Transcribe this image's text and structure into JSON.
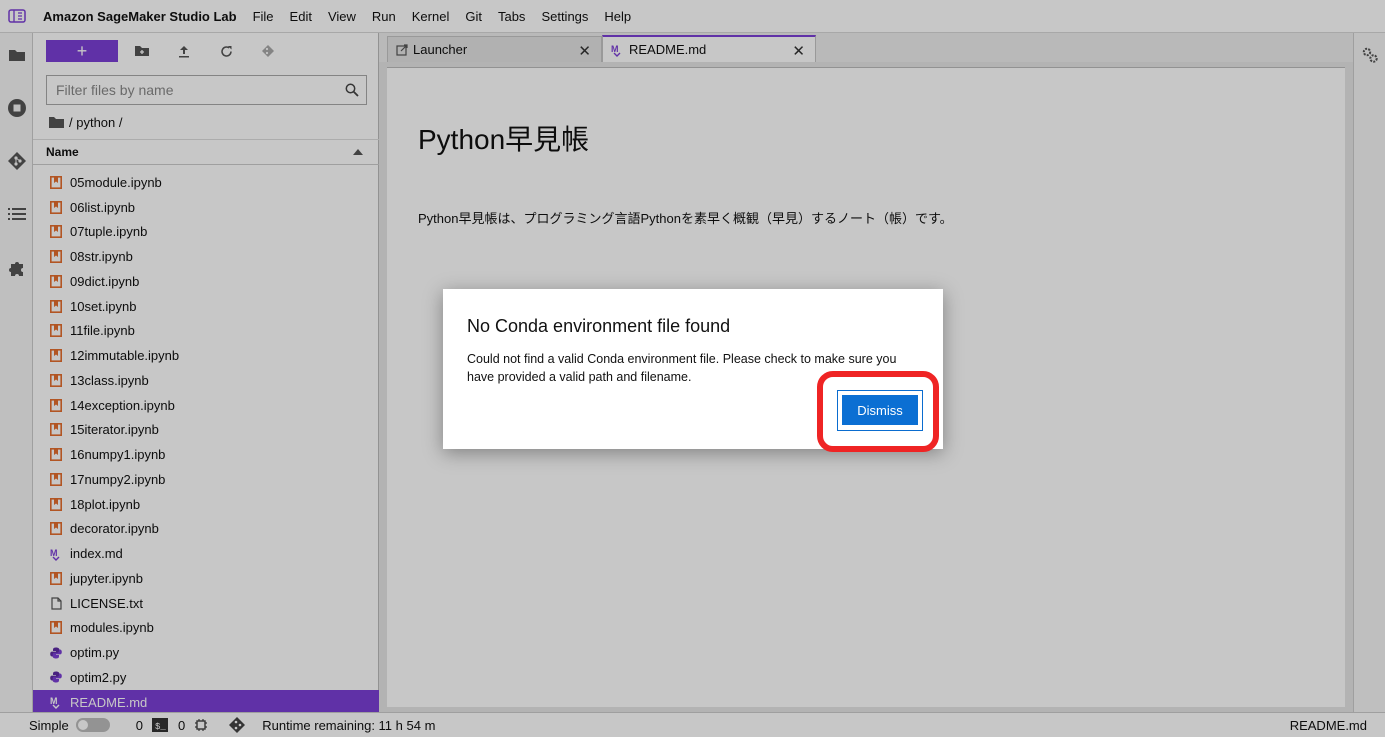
{
  "app": {
    "title": "Amazon SageMaker Studio Lab"
  },
  "menu": [
    "File",
    "Edit",
    "View",
    "Run",
    "Kernel",
    "Git",
    "Tabs",
    "Settings",
    "Help"
  ],
  "file_browser": {
    "new_button_label": "+",
    "filter_placeholder": "Filter files by name",
    "breadcrumb": "/ python /",
    "column_name": "Name",
    "files": [
      {
        "name": "05module.ipynb",
        "type": "notebook"
      },
      {
        "name": "06list.ipynb",
        "type": "notebook"
      },
      {
        "name": "07tuple.ipynb",
        "type": "notebook"
      },
      {
        "name": "08str.ipynb",
        "type": "notebook"
      },
      {
        "name": "09dict.ipynb",
        "type": "notebook"
      },
      {
        "name": "10set.ipynb",
        "type": "notebook"
      },
      {
        "name": "11file.ipynb",
        "type": "notebook"
      },
      {
        "name": "12immutable.ipynb",
        "type": "notebook"
      },
      {
        "name": "13class.ipynb",
        "type": "notebook"
      },
      {
        "name": "14exception.ipynb",
        "type": "notebook"
      },
      {
        "name": "15iterator.ipynb",
        "type": "notebook"
      },
      {
        "name": "16numpy1.ipynb",
        "type": "notebook"
      },
      {
        "name": "17numpy2.ipynb",
        "type": "notebook"
      },
      {
        "name": "18plot.ipynb",
        "type": "notebook"
      },
      {
        "name": "decorator.ipynb",
        "type": "notebook"
      },
      {
        "name": "index.md",
        "type": "markdown"
      },
      {
        "name": "jupyter.ipynb",
        "type": "notebook"
      },
      {
        "name": "LICENSE.txt",
        "type": "text"
      },
      {
        "name": "modules.ipynb",
        "type": "notebook"
      },
      {
        "name": "optim.py",
        "type": "python"
      },
      {
        "name": "optim2.py",
        "type": "python"
      },
      {
        "name": "README.md",
        "type": "markdown",
        "selected": true
      }
    ]
  },
  "tabs": [
    {
      "label": "Launcher",
      "icon": "launcher-icon",
      "active": false
    },
    {
      "label": "README.md",
      "icon": "markdown-icon",
      "active": true
    }
  ],
  "document": {
    "heading": "Python早見帳",
    "paragraph": "Python早見帳は、プログラミング言語Pythonを素早く概観（早見）するノート（帳）です。"
  },
  "dialog": {
    "title": "No Conda environment file found",
    "message": "Could not find a valid Conda environment file. Please check to make sure you have provided a valid path and filename.",
    "dismiss_label": "Dismiss"
  },
  "status": {
    "mode_label": "Simple",
    "terminals_count": "0",
    "kernels_count": "0",
    "runtime": "Runtime remaining: 11 h 54 m",
    "current_file": "README.md"
  },
  "colors": {
    "accent": "#7c3fd6",
    "notebook_icon": "#e46e2e",
    "markdown_icon": "#7c3fd6",
    "python_icon": "#5e2ca5",
    "primary_button": "#0b6fd3",
    "highlight": "#ef2424"
  }
}
